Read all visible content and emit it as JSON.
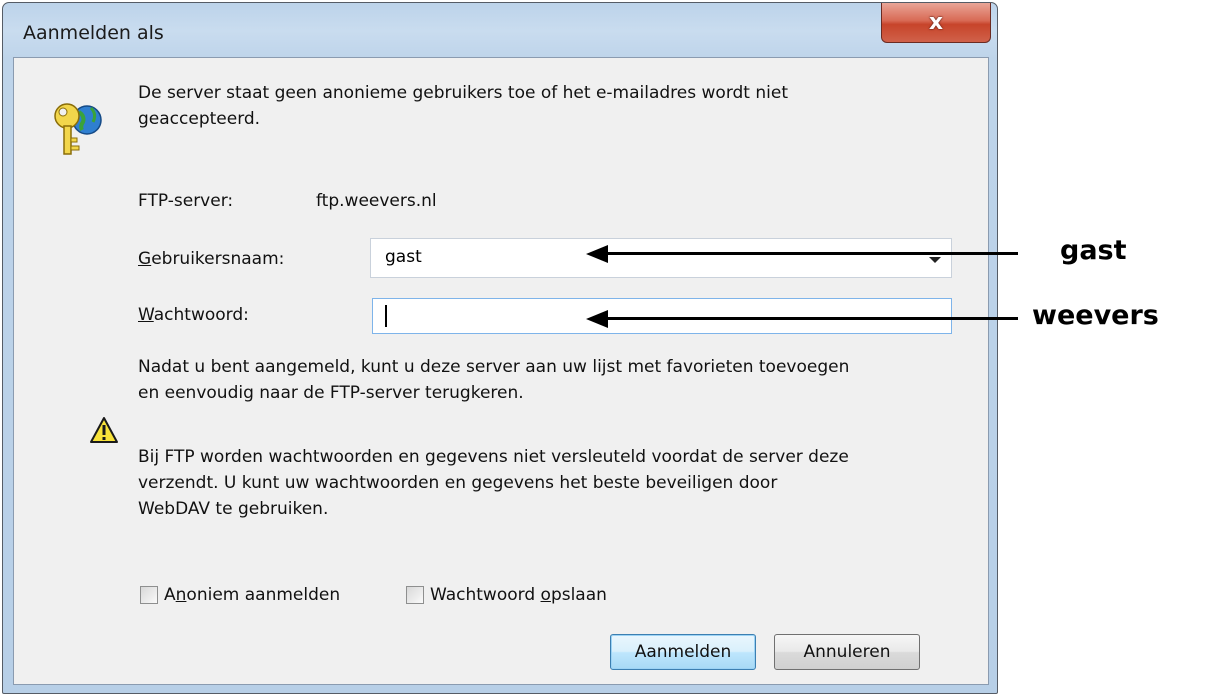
{
  "window": {
    "title": "Aanmelden als",
    "close_glyph": "x"
  },
  "message": {
    "line1": "De server staat geen anonieme gebruikers toe of het e-mailadres wordt niet",
    "line2": "geaccepteerd."
  },
  "ftp_server": {
    "label": "FTP-server:",
    "value": "ftp.weevers.nl"
  },
  "username": {
    "label_mnemonic": "G",
    "label_rest": "ebruikersnaam:",
    "value": "gast"
  },
  "password": {
    "label_mnemonic": "W",
    "label_rest": "achtwoord:",
    "value": ""
  },
  "info": {
    "line1": "Nadat u bent aangemeld, kunt u deze server aan uw lijst met favorieten toevoegen",
    "line2": "en eenvoudig naar de FTP-server terugkeren."
  },
  "warning": {
    "line1": "Bij FTP worden wachtwoorden en gegevens niet versleuteld voordat de server deze",
    "line2": "verzendt. U kunt uw wachtwoorden en gegevens het beste beveiligen door",
    "line3": "WebDAV te gebruiken."
  },
  "anonymous_checkbox": {
    "pre": "A",
    "mnemonic": "n",
    "post": "oniem aanmelden",
    "checked": false
  },
  "save_password_checkbox": {
    "pre": "Wachtwoord ",
    "mnemonic": "o",
    "post": "pslaan",
    "checked": false
  },
  "buttons": {
    "login": "Aanmelden",
    "cancel": "Annuleren"
  },
  "annotations": {
    "username_hint": "gast",
    "password_hint": "weevers"
  },
  "icons": {
    "key": "key-globe-icon",
    "warning": "warning-icon"
  }
}
